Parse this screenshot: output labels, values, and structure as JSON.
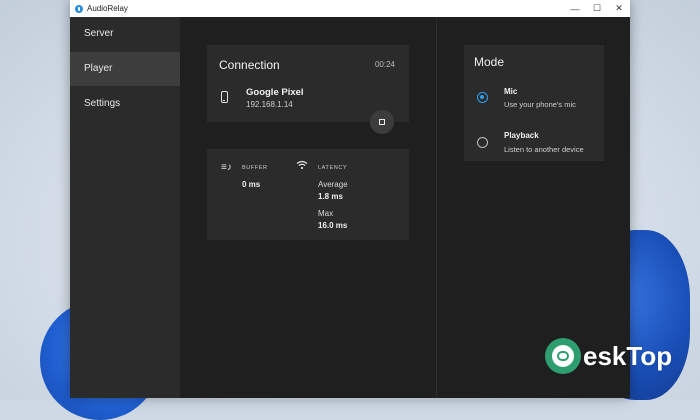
{
  "window": {
    "title": "AudioRelay",
    "controls": {
      "minimize": "—",
      "maximize": "☐",
      "close": "✕"
    }
  },
  "sidebar": {
    "items": [
      {
        "label": "Server",
        "active": false
      },
      {
        "label": "Player",
        "active": true
      },
      {
        "label": "Settings",
        "active": false
      }
    ]
  },
  "connection": {
    "title": "Connection",
    "timer": "00:24",
    "device_name": "Google Pixel",
    "device_ip": "192.168.1.14"
  },
  "stats": {
    "buffer_label": "BUFFER",
    "buffer_value": "0 ms",
    "latency_label": "LATENCY",
    "average_label": "Average",
    "average_value": "1.8 ms",
    "max_label": "Max",
    "max_value": "16.0 ms"
  },
  "mode": {
    "title": "Mode",
    "options": [
      {
        "title": "Mic",
        "desc": "Use your phone's mic",
        "selected": true
      },
      {
        "title": "Playback",
        "desc": "Listen to another device",
        "selected": false
      }
    ]
  },
  "watermark": {
    "text": "eskTop"
  },
  "colors": {
    "accent": "#2e9df0",
    "window_bg": "#1f1f1f",
    "card_bg": "#2b2b2b"
  }
}
